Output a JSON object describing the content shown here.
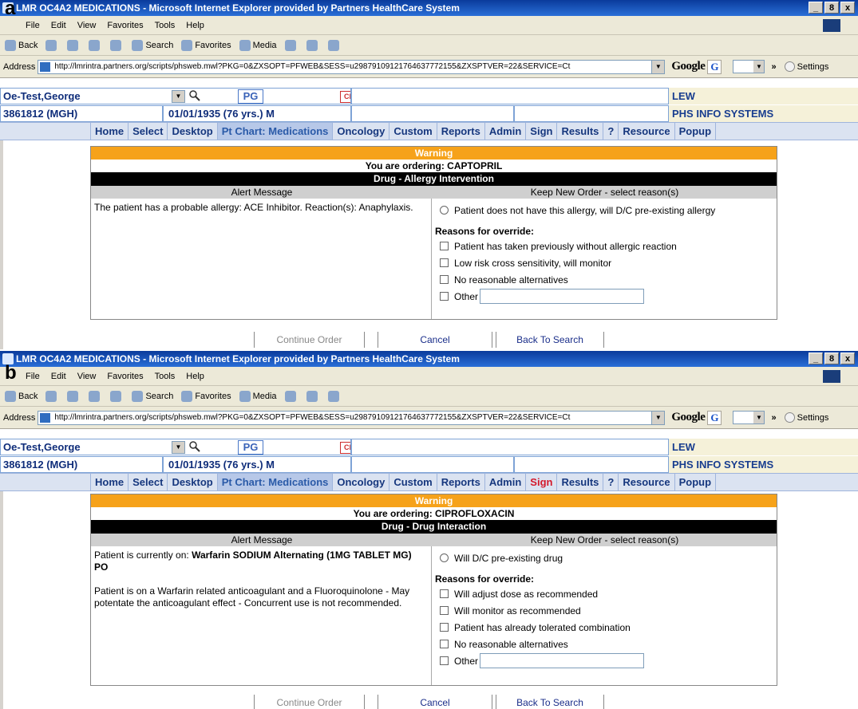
{
  "panels": [
    {
      "label": "a",
      "browser": {
        "title": "LMR OC4A2 MEDICATIONS - Microsoft Internet Explorer provided by Partners HealthCare System",
        "window_buttons": [
          "_",
          "8",
          "x"
        ],
        "menu": [
          "File",
          "Edit",
          "View",
          "Favorites",
          "Tools",
          "Help"
        ],
        "toolbar": [
          "Back",
          "Search",
          "Favorites",
          "Media"
        ],
        "address_label": "Address",
        "address_url": "http://lmrintra.partners.org/scripts/phsweb.mwl?PKG=0&ZXSOPT=PFWEB&SESS=u29879109121764637772155&ZXSPTVER=22&SERVICE=Ct",
        "google_label": "Google",
        "google_g": "G",
        "chevron": "»",
        "settings": "Settings"
      },
      "patient": {
        "name": "Oe-Test,George",
        "mrn": "3861812 (MGH)",
        "dob": "01/01/1935 (76 yrs.) M",
        "pg": "PG",
        "cmp": "CMP",
        "provider": "LEW",
        "org": "PHS INFO SYSTEMS"
      },
      "nav": [
        "Home",
        "Select",
        "Desktop",
        "Pt Chart: Medications",
        "Oncology",
        "Custom",
        "Reports",
        "Admin",
        "Sign",
        "Results",
        "?",
        "Resource",
        "Popup"
      ],
      "alert": {
        "warning": "Warning",
        "ordering": "You are ordering: CAPTOPRIL",
        "type": "Drug - Allergy Intervention",
        "col_left": "Alert Message",
        "col_right": "Keep New Order - select reason(s)",
        "message_1": "The patient has a probable allergy: ACE Inhibitor. Reaction(s): Anaphylaxis.",
        "radio_option": "Patient does not have this allergy, will D/C pre-existing allergy",
        "reasons_header": "Reasons for override:",
        "reasons": [
          "Patient has taken previously without allergic reaction",
          "Low risk cross sensitivity, will monitor",
          "No reasonable alternatives",
          "Other"
        ]
      },
      "buttons": {
        "continue": "Continue Order",
        "cancel": "Cancel",
        "back": "Back To Search"
      }
    },
    {
      "label": "b",
      "browser": {
        "title": "LMR OC4A2 MEDICATIONS - Microsoft Internet Explorer provided by Partners HealthCare System",
        "window_buttons": [
          "_",
          "8",
          "x"
        ],
        "menu": [
          "File",
          "Edit",
          "View",
          "Favorites",
          "Tools",
          "Help"
        ],
        "toolbar": [
          "Back",
          "Search",
          "Favorites",
          "Media"
        ],
        "address_label": "Address",
        "address_url": "http://lmrintra.partners.org/scripts/phsweb.mwl?PKG=0&ZXSOPT=PFWEB&SESS=u29879109121764637772155&ZXSPTVER=22&SERVICE=Ct",
        "google_label": "Google",
        "google_g": "G",
        "chevron": "»",
        "settings": "Settings"
      },
      "patient": {
        "name": "Oe-Test,George",
        "mrn": "3861812 (MGH)",
        "dob": "01/01/1935 (76 yrs.) M",
        "pg": "PG",
        "cmp": "CMP",
        "provider": "LEW",
        "org": "PHS INFO SYSTEMS"
      },
      "nav": [
        "Home",
        "Select",
        "Desktop",
        "Pt Chart: Medications",
        "Oncology",
        "Custom",
        "Reports",
        "Admin",
        "Sign",
        "Results",
        "?",
        "Resource",
        "Popup"
      ],
      "alert": {
        "warning": "Warning",
        "ordering": "You are ordering: CIPROFLOXACIN",
        "type": "Drug - Drug Interaction",
        "col_left": "Alert Message",
        "col_right": "Keep New Order - select reason(s)",
        "message_1_prefix": "Patient is currently on: ",
        "message_1_bold": "Warfarin SODIUM Alternating (1MG TABLET MG) PO",
        "message_2": "Patient is on a Warfarin related anticoagulant and a Fluoroquinolone - May potentate the anticoagulant effect - Concurrent use is not recommended.",
        "radio_option": "Will D/C pre-existing drug",
        "reasons_header": "Reasons for override:",
        "reasons": [
          "Will adjust dose as recommended",
          "Will monitor as recommended",
          "Patient has already tolerated combination",
          "No reasonable alternatives",
          "Other"
        ]
      },
      "buttons": {
        "continue": "Continue Order",
        "cancel": "Cancel",
        "back": "Back To Search"
      }
    }
  ]
}
